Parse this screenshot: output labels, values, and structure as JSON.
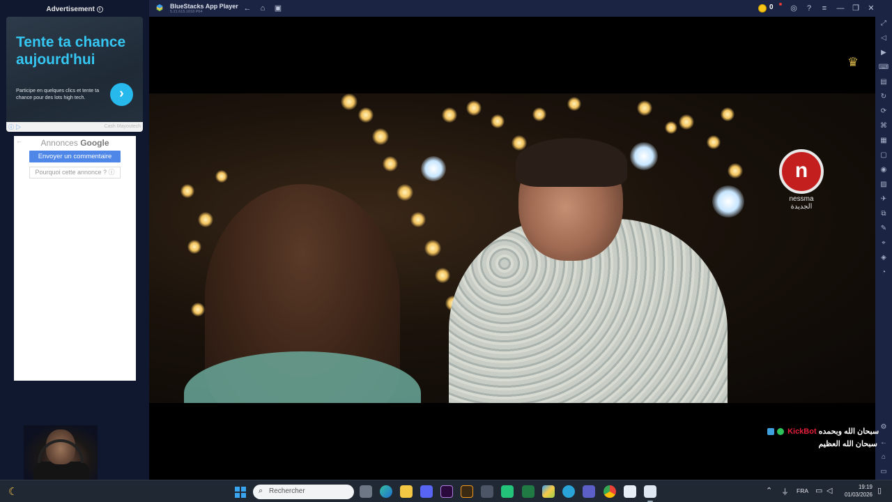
{
  "left_ad": {
    "header": "Advertisement",
    "title": "Tente ta chance aujourd'hui",
    "description": "Participe en quelques clics et tente ta chance pour des lots high tech.",
    "arrow": "›",
    "footer_brand": "Cash Mayoutech"
  },
  "google_ads": {
    "title_prefix": "Annonces ",
    "title_brand": "Google",
    "send_feedback": "Envoyer un commentaire",
    "why_this_ad": "Pourquoi cette annonce ?"
  },
  "app": {
    "title": "BlueStacks App Player",
    "version": "5.21.615.1018  P64",
    "coins": "0",
    "accent": "#1b2442"
  },
  "video": {
    "channel_logo_text": "nessma الجديدة",
    "channel_logo_glyph": "n"
  },
  "chat": {
    "username": "KickBot",
    "line1_text": "سبحان الله وبحمده",
    "line2_text": "سبحان الله العظيم"
  },
  "taskbar": {
    "search_placeholder": "Rechercher",
    "language": "FRA",
    "time": "19:19",
    "date": "01/03/2026"
  },
  "colors": {
    "ad_accent": "#35c6f2",
    "google_button": "#4e87e8",
    "chat_user": "#e51e3a",
    "coin": "#f5c518"
  }
}
